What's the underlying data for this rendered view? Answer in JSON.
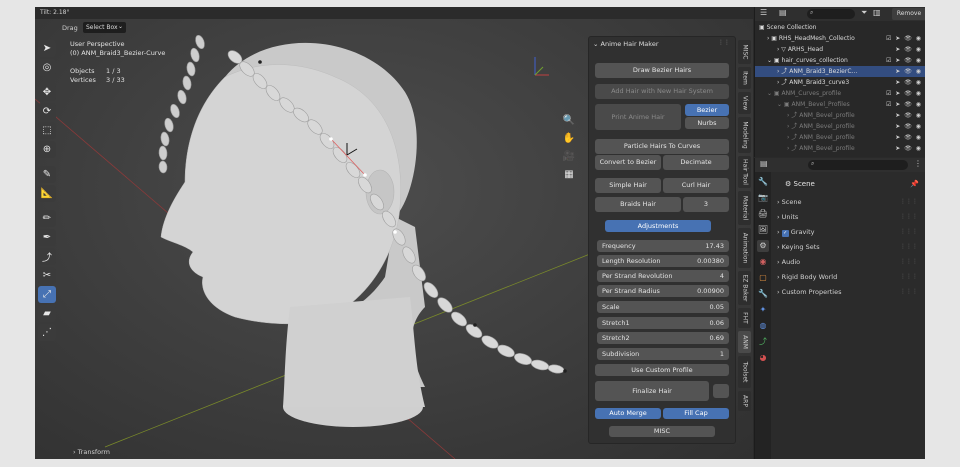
{
  "viewport": {
    "tilt": "Tilt: 2.18°",
    "drag_label": "Drag",
    "select_mode": "Select Box",
    "perspective": "User Perspective",
    "active_object": "(0) ANM_Braid3_Bezier-Curve",
    "objects_label": "Objects",
    "objects_value": "1 / 3",
    "vertices_label": "Vertices",
    "vertices_value": "3 / 33",
    "transform_label": "Transform"
  },
  "hair_panel": {
    "title": "Anime Hair Maker",
    "draw_bezier": "Draw Bezier Hairs",
    "add_hair_system": "Add Hair with New Hair System",
    "print_hair": "Print Anime Hair",
    "bezier": "Bezier",
    "nurbs": "Nurbs",
    "particle_to_curves": "Particle Hairs To Curves",
    "convert_bezier": "Convert to Bezier",
    "decimate": "Decimate",
    "simple_hair": "Simple Hair",
    "curl_hair": "Curl Hair",
    "braids_hair": "Braids Hair",
    "braids_count": "3",
    "adjustments": "Adjustments",
    "fields": [
      {
        "label": "Frequency",
        "value": "17.43"
      },
      {
        "label": "Length Resolution",
        "value": "0.00380"
      },
      {
        "label": "Per Strand Revolution",
        "value": "4"
      },
      {
        "label": "Per Strand Radius",
        "value": "0.00900"
      },
      {
        "label": "Scale",
        "value": "0.05"
      },
      {
        "label": "Stretch1",
        "value": "0.06"
      },
      {
        "label": "Stretch2",
        "value": "0.69"
      },
      {
        "label": "Subdivision",
        "value": "1"
      }
    ],
    "use_custom_profile": "Use Custom Profile",
    "finalize": "Finalize Hair",
    "auto_merge": "Auto Merge",
    "fill_cap": "Fill Cap",
    "misc": "MISC"
  },
  "side_tabs": [
    "MISC",
    "Item",
    "View",
    "Modeling",
    "Hair Tool",
    "Material",
    "Animation",
    "EZ Baker",
    "FHT",
    "ANM",
    "Toolset",
    "ARP"
  ],
  "outliner": {
    "search_placeholder": "",
    "remove_label": "Remove",
    "rows": [
      {
        "label": "Scene Collection"
      },
      {
        "label": "RHS_HeadMesh_Collectio"
      },
      {
        "label": "ARHS_Head"
      },
      {
        "label": "hair_curves_collection"
      },
      {
        "label": "ANM_Braid3_BezierC..."
      },
      {
        "label": "ANM_Braid3_curve3"
      },
      {
        "label": "ANM_Curves_profile"
      },
      {
        "label": "ANM_Bevel_Profiles"
      },
      {
        "label": "ANM_Bevel_profile"
      },
      {
        "label": "ANM_Bevel_profile"
      },
      {
        "label": "ANM_Bevel_profile"
      },
      {
        "label": "ANM_Bevel_profile"
      }
    ]
  },
  "properties": {
    "scene_title": "Scene",
    "rows": [
      "Scene",
      "Units",
      "Gravity",
      "Keying Sets",
      "Audio",
      "Rigid Body World",
      "Custom Properties"
    ]
  },
  "colors": {
    "accent": "#4772b3",
    "selection": "#334d80",
    "bg": "#3d3d3d"
  }
}
